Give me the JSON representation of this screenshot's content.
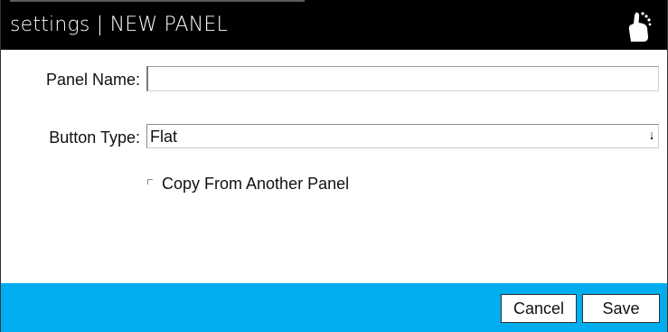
{
  "window": {
    "title": "settings | NEW PANEL",
    "logo_icon": "hand-pointer-icon"
  },
  "form": {
    "panel_name": {
      "label": "Panel Name:",
      "value": "",
      "placeholder": ""
    },
    "button_type": {
      "label": "Button Type:",
      "selected": "Flat",
      "arrow_icon": "chevron-down-icon"
    },
    "copy_option": {
      "label": "Copy From Another Panel",
      "checked": false
    }
  },
  "footer": {
    "cancel_label": "Cancel",
    "save_label": "Save"
  },
  "colors": {
    "titlebar": "#000000",
    "footer": "#00aeef",
    "title_text": "#ffffff"
  }
}
